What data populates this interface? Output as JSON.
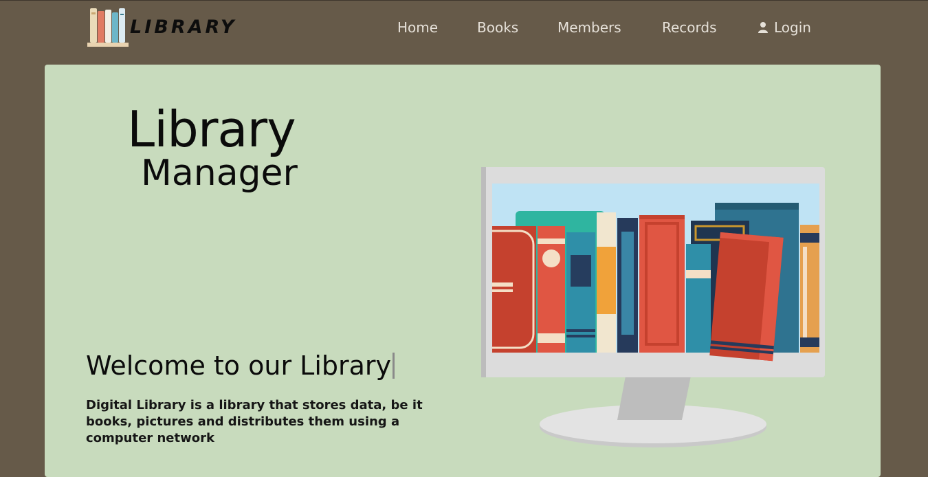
{
  "brand": {
    "logo_text": "LIBRARY"
  },
  "nav": {
    "items": [
      {
        "label": "Home"
      },
      {
        "label": "Books"
      },
      {
        "label": "Members"
      },
      {
        "label": "Records"
      },
      {
        "label": "Login",
        "icon": "user-icon"
      }
    ]
  },
  "hero": {
    "title_line1": "Library",
    "title_line2": "Manager",
    "welcome": "Welcome to our Library",
    "description": "Digital Library is a library that stores data, be it books, pictures and distributes them using a computer network",
    "illustration": "computer-with-books-illustration"
  },
  "colors": {
    "background": "#665a49",
    "card": "#c8dbbd",
    "nav_text": "#e6e1d9",
    "text": "#0b0b0b"
  }
}
